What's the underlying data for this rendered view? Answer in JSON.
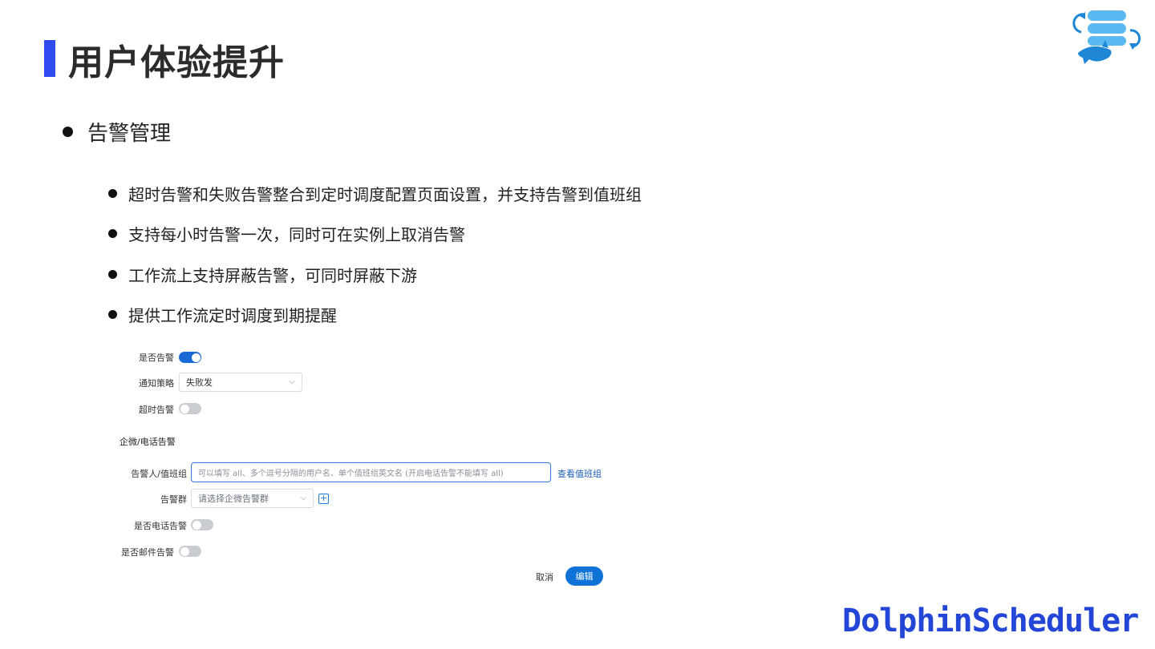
{
  "page": {
    "title": "用户体验提升",
    "brand": "DolphinScheduler"
  },
  "section": {
    "heading": "告警管理",
    "items": [
      "超时告警和失败告警整合到定时调度配置页面设置，并支持告警到值班组",
      "支持每小时告警一次，同时可在实例上取消告警",
      "工作流上支持屏蔽告警，可同时屏蔽下游",
      "提供工作流定时调度到期提醒"
    ]
  },
  "form": {
    "alert_enabled_label": "是否告警",
    "alert_enabled": true,
    "notify_policy_label": "通知策略",
    "notify_policy_value": "失败发",
    "timeout_alert_label": "超时告警",
    "timeout_alert": false,
    "wecom_section_title": "企微/电话告警",
    "recipients_label": "告警人/值班组",
    "recipients_placeholder": "可以填写 all、多个逗号分隔的用户名、单个值班组英文名 (开启电话告警不能填写 all)",
    "view_duty_link": "查看值班组",
    "alert_group_label": "告警群",
    "alert_group_placeholder": "请选择企微告警群",
    "phone_alert_label": "是否电话告警",
    "phone_alert": false,
    "email_alert_label": "是否邮件告警",
    "email_alert": false,
    "cancel_label": "取消",
    "edit_label": "编辑"
  },
  "colors": {
    "accent": "#2f4bf0",
    "primary_button": "#0f72d6",
    "brand": "#2346d6"
  },
  "icons": {
    "logo": "dolphin-database-logo-icon",
    "dropdown": "chevron-down-icon",
    "add": "plus-square-icon"
  }
}
